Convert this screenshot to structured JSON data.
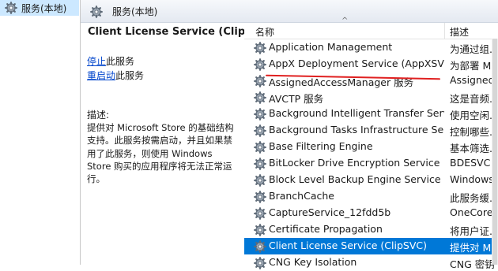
{
  "tree": {
    "label": "服务(本地)"
  },
  "header": {
    "title": "服务(本地)"
  },
  "details": {
    "service_title": "Client License Service (ClipSVC)",
    "stop_link": "停止",
    "stop_suffix": "此服务",
    "restart_link": "重启动",
    "restart_suffix": "此服务",
    "desc_label": "描述:",
    "desc_lines": [
      "提供对 Microsoft Store 的基础结构",
      "支持。此服务按需启动，并且如果禁",
      "用了此服务，则使用 Windows",
      "Store 购买的应用程序将无法正常运",
      "行。"
    ]
  },
  "list": {
    "columns": {
      "name": "名称",
      "description": "描述"
    },
    "rows": [
      {
        "name": "Application Management",
        "desc": "为通过组..."
      },
      {
        "name": "AppX Deployment Service (AppXSVC)",
        "desc": "为部署 M..."
      },
      {
        "name": "AssignedAccessManager 服务",
        "desc": "Assigned..."
      },
      {
        "name": "AVCTP 服务",
        "desc": "这是音频..."
      },
      {
        "name": "Background Intelligent Transfer Servi...",
        "desc": "使用空闲..."
      },
      {
        "name": "Background Tasks Infrastructure Servi...",
        "desc": "控制哪些..."
      },
      {
        "name": "Base Filtering Engine",
        "desc": "基本筛选..."
      },
      {
        "name": "BitLocker Drive Encryption Service",
        "desc": "BDESVC ..."
      },
      {
        "name": "Block Level Backup Engine Service",
        "desc": "Windows ..."
      },
      {
        "name": "BranchCache",
        "desc": "此服务缓..."
      },
      {
        "name": "CaptureService_12fdd5b",
        "desc": "OneCore ..."
      },
      {
        "name": "Certificate Propagation",
        "desc": "将用户证..."
      },
      {
        "name": "Client License Service (ClipSVC)",
        "desc": "提供对 Mi..."
      },
      {
        "name": "CNG Key Isolation",
        "desc": "CNG 密钥..."
      }
    ],
    "selected_index": 12
  },
  "colors": {
    "selection": "#0078d7",
    "annotation": "#e02020",
    "link": "#0044cc"
  },
  "icons": {
    "service": "gear-icon"
  }
}
